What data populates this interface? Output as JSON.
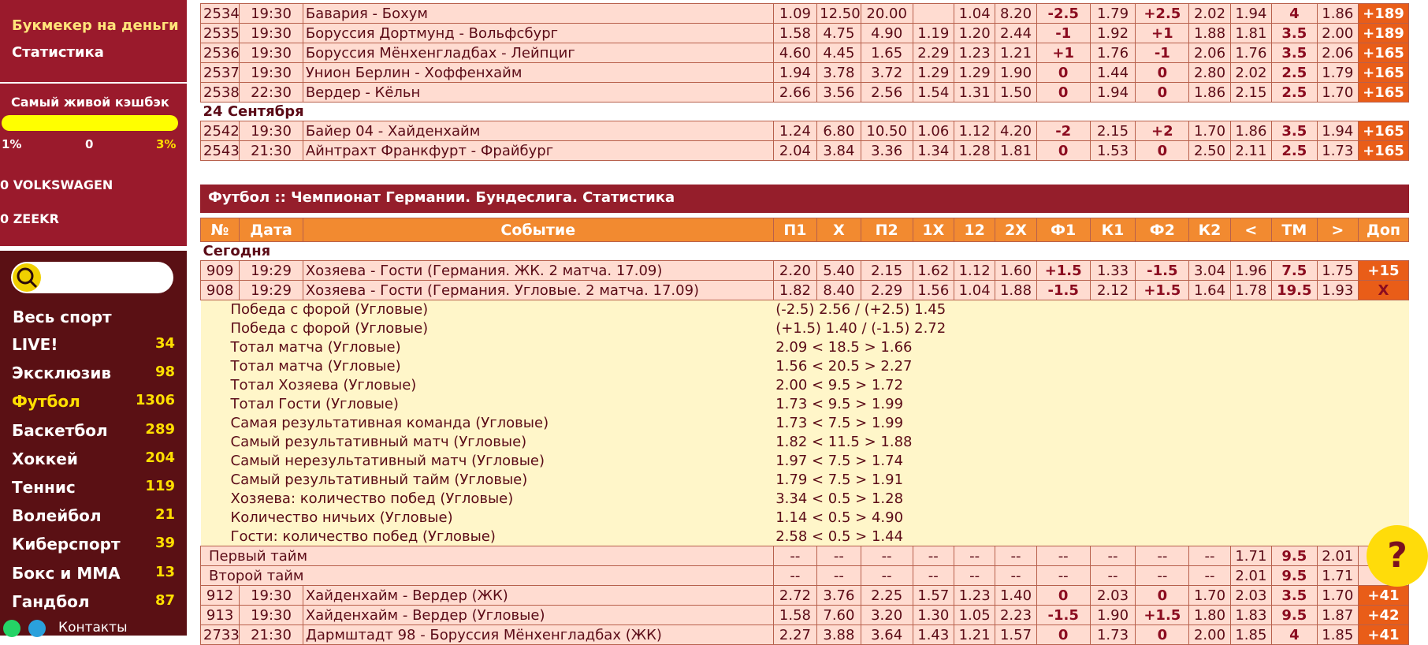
{
  "sidebar": {
    "links": [
      "Букмекер на деньги",
      "Статистика"
    ],
    "cashback": {
      "title": "Самый живой кэшбэк",
      "left": "1%",
      "mid": "0",
      "right": "3%"
    },
    "cars": [
      "0 VOLKSWAGEN",
      "0 ZEEKR"
    ],
    "all_sports": "Весь спорт",
    "sports": [
      {
        "name": "LIVE!",
        "count": "34"
      },
      {
        "name": "Эксклюзив",
        "count": "98"
      },
      {
        "name": "Футбол",
        "count": "1306",
        "active": true
      },
      {
        "name": "Баскетбол",
        "count": "289"
      },
      {
        "name": "Хоккей",
        "count": "204"
      },
      {
        "name": "Теннис",
        "count": "119"
      },
      {
        "name": "Волейбол",
        "count": "21"
      },
      {
        "name": "Киберспорт",
        "count": "39"
      },
      {
        "name": "Бокс и ММА",
        "count": "13"
      },
      {
        "name": "Гандбол",
        "count": "87"
      }
    ],
    "contacts": "Контакты"
  },
  "top_table": {
    "rows": [
      {
        "cells": [
          "2534",
          "19:30",
          "Бавария - Бохум",
          "1.09",
          "12.50",
          "20.00",
          "",
          "1.04",
          "8.20",
          "-2.5",
          "1.79",
          "+2.5",
          "2.02",
          "1.94",
          "4",
          "1.86",
          "+189"
        ]
      },
      {
        "cells": [
          "2535",
          "19:30",
          "Боруссия Дортмунд - Вольфсбург",
          "1.58",
          "4.75",
          "4.90",
          "1.19",
          "1.20",
          "2.44",
          "-1",
          "1.92",
          "+1",
          "1.88",
          "1.81",
          "3.5",
          "2.00",
          "+189"
        ]
      },
      {
        "cells": [
          "2536",
          "19:30",
          "Боруссия Мёнхенгладбах - Лейпциг",
          "4.60",
          "4.45",
          "1.65",
          "2.29",
          "1.23",
          "1.21",
          "+1",
          "1.76",
          "-1",
          "2.06",
          "1.76",
          "3.5",
          "2.06",
          "+165"
        ]
      },
      {
        "cells": [
          "2537",
          "19:30",
          "Унион Берлин - Хоффенхайм",
          "1.94",
          "3.78",
          "3.72",
          "1.29",
          "1.29",
          "1.90",
          "0",
          "1.44",
          "0",
          "2.80",
          "2.02",
          "2.5",
          "1.79",
          "+165"
        ]
      },
      {
        "cells": [
          "2538",
          "22:30",
          "Вердер - Кёльн",
          "2.66",
          "3.56",
          "2.56",
          "1.54",
          "1.31",
          "1.50",
          "0",
          "1.94",
          "0",
          "1.86",
          "2.15",
          "2.5",
          "1.70",
          "+165"
        ]
      },
      {
        "date": "24 Сентября"
      },
      {
        "cells": [
          "2542",
          "19:30",
          "Байер 04 - Хайденхайм",
          "1.24",
          "6.80",
          "10.50",
          "1.06",
          "1.12",
          "4.20",
          "-2",
          "2.15",
          "+2",
          "1.70",
          "1.86",
          "3.5",
          "1.94",
          "+165"
        ]
      },
      {
        "cells": [
          "2543",
          "21:30",
          "Айнтрахт Франкфурт - Фрайбург",
          "2.04",
          "3.84",
          "3.36",
          "1.34",
          "1.28",
          "1.81",
          "0",
          "1.53",
          "0",
          "2.50",
          "2.11",
          "2.5",
          "1.73",
          "+165"
        ]
      }
    ]
  },
  "section_title": "Футбол :: Чемпионат Германии. Бундеслига. Статистика",
  "stats_table": {
    "headers": [
      "№",
      "Дата",
      "Событие",
      "П1",
      "Х",
      "П2",
      "1Х",
      "12",
      "2Х",
      "Ф1",
      "К1",
      "Ф2",
      "К2",
      "<",
      "ТМ",
      ">",
      "Доп"
    ],
    "today_label": "Сегодня",
    "rows": [
      {
        "cells": [
          "909",
          "19:29",
          "Хозяева - Гости (Германия. ЖК. 2 матча. 17.09)",
          "2.20",
          "5.40",
          "2.15",
          "1.62",
          "1.12",
          "1.60",
          "+1.5",
          "1.33",
          "-1.5",
          "3.04",
          "1.96",
          "7.5",
          "1.75",
          "+15"
        ]
      },
      {
        "cells": [
          "908",
          "19:29",
          "Хозяева - Гости (Германия. Угловые. 2 матча. 17.09)",
          "1.82",
          "8.40",
          "2.29",
          "1.56",
          "1.04",
          "1.88",
          "-1.5",
          "2.12",
          "+1.5",
          "1.64",
          "1.78",
          "19.5",
          "1.93",
          "X"
        ]
      }
    ],
    "details": [
      {
        "name": "Победа с форой (Угловые)",
        "value": "(-2.5) 2.56 / (+2.5) 1.45"
      },
      {
        "name": "Победа с форой (Угловые)",
        "value": "(+1.5) 1.40 / (-1.5) 2.72"
      },
      {
        "name": "Тотал матча (Угловые)",
        "value": "2.09 < 18.5 > 1.66"
      },
      {
        "name": "Тотал матча (Угловые)",
        "value": "1.56 < 20.5 > 2.27"
      },
      {
        "name": "Тотал Хозяева (Угловые)",
        "value": "2.00 < 9.5 > 1.72"
      },
      {
        "name": "Тотал Гости (Угловые)",
        "value": "1.73 < 9.5 > 1.99"
      },
      {
        "name": "Самая результативная команда (Угловые)",
        "value": "1.73 < 7.5 > 1.99"
      },
      {
        "name": "Самый результативный матч (Угловые)",
        "value": "1.82 < 11.5 > 1.88"
      },
      {
        "name": "Самый нерезультативный матч (Угловые)",
        "value": "1.97 < 7.5 > 1.74"
      },
      {
        "name": "Самый результативный тайм (Угловые)",
        "value": "1.79 < 7.5 > 1.91"
      },
      {
        "name": "Хозяева: количество побед (Угловые)",
        "value": "3.34 < 0.5 > 1.28"
      },
      {
        "name": "Количество ничьих (Угловые)",
        "value": "1.14 < 0.5 > 4.90"
      },
      {
        "name": "Гости: количество побед (Угловые)",
        "value": "2.58 < 0.5 > 1.44"
      }
    ],
    "halves": [
      {
        "name": "Первый тайм",
        "cells": [
          "--",
          "--",
          "--",
          "--",
          "--",
          "--",
          "--",
          "--",
          "--",
          "--",
          "1.71",
          "9.5",
          "2.01",
          ""
        ]
      },
      {
        "name": "Второй тайм",
        "cells": [
          "--",
          "--",
          "--",
          "--",
          "--",
          "--",
          "--",
          "--",
          "--",
          "--",
          "2.01",
          "9.5",
          "1.71",
          ""
        ]
      }
    ],
    "rows_after": [
      {
        "cells": [
          "912",
          "19:30",
          "Хайденхайм - Вердер (ЖК)",
          "2.72",
          "3.76",
          "2.25",
          "1.57",
          "1.23",
          "1.40",
          "0",
          "2.03",
          "0",
          "1.70",
          "2.03",
          "3.5",
          "1.70",
          "+41"
        ]
      },
      {
        "cells": [
          "913",
          "19:30",
          "Хайденхайм - Вердер (Угловые)",
          "1.58",
          "7.60",
          "3.20",
          "1.30",
          "1.05",
          "2.23",
          "-1.5",
          "1.90",
          "+1.5",
          "1.80",
          "1.83",
          "9.5",
          "1.87",
          "+42"
        ]
      },
      {
        "cells": [
          "2733",
          "21:30",
          "Дармштадт 98 - Боруссия Мёнхенгладбах (ЖК)",
          "2.27",
          "3.88",
          "3.64",
          "1.43",
          "1.21",
          "1.57",
          "0",
          "1.73",
          "0",
          "2.00",
          "1.85",
          "4",
          "1.85",
          "+41"
        ]
      }
    ]
  },
  "help_button": "?",
  "colors": {
    "accent": "#9a1a2c",
    "header": "#f28a30",
    "row": "#ffdcd1",
    "highlight": "#ffff00",
    "extra": "#e95d18"
  }
}
